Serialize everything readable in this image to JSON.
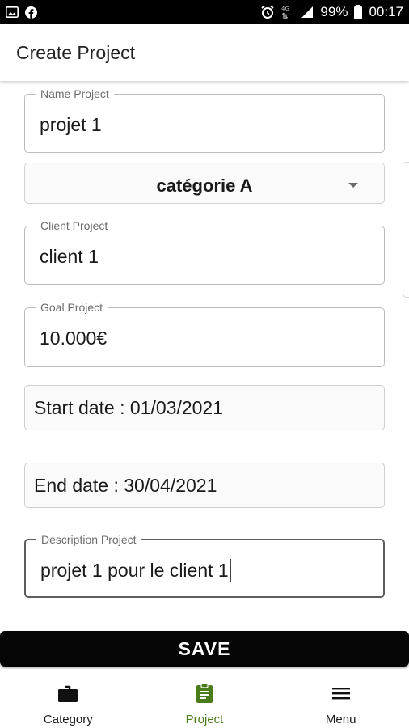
{
  "status_bar": {
    "battery": "99%",
    "time": "00:17",
    "network": "4G"
  },
  "app_bar": {
    "title": "Create Project"
  },
  "form": {
    "name": {
      "label": "Name Project",
      "value": "projet 1"
    },
    "category": {
      "value": "catégorie A"
    },
    "client": {
      "label": "Client Project",
      "value": "client 1"
    },
    "goal": {
      "label": "Goal Project",
      "value": "10.000€"
    },
    "start_date": {
      "value": "Start date : 01/03/2021"
    },
    "end_date": {
      "value": "End date : 30/04/2021"
    },
    "description": {
      "label": "Description Project",
      "value": "projet 1 pour le client 1"
    }
  },
  "save": {
    "label": "SAVE"
  },
  "bottom_nav": {
    "items": [
      {
        "label": "Category",
        "icon": "briefcase-icon"
      },
      {
        "label": "Project",
        "icon": "clipboard-icon",
        "active": true
      },
      {
        "label": "Menu",
        "icon": "hamburger-menu-icon"
      }
    ]
  },
  "colors": {
    "accent": "#4a7c1a",
    "save_bg": "#050505",
    "status_bar_bg": "#000000"
  }
}
